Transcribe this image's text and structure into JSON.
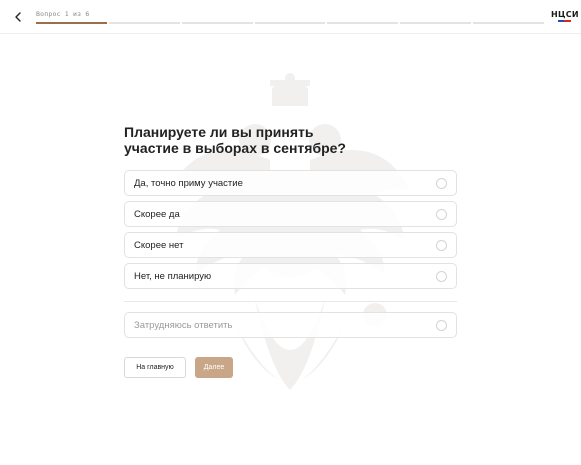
{
  "header": {
    "progress_label": "Вопрос 1 из 6",
    "progress": {
      "current": 1,
      "total": 7
    },
    "logo_text": "НЦСИ",
    "logo_flag_colors": [
      "#ffffff",
      "#1c4fb8",
      "#d52b1e"
    ]
  },
  "colors": {
    "accent": "#9b6e49",
    "button_primary": "#c9a688"
  },
  "question": {
    "line1": "Планируете ли вы принять",
    "line2": "участие в выборах в сентябре?"
  },
  "options": [
    {
      "label": "Да, точно приму участие",
      "selected": false
    },
    {
      "label": "Скорее да",
      "selected": false
    },
    {
      "label": "Скорее нет",
      "selected": false
    },
    {
      "label": "Нет, не планирую",
      "selected": false
    }
  ],
  "other_option": {
    "label": "Затрудняюсь ответить",
    "selected": false
  },
  "buttons": {
    "home_label": "На главную",
    "next_label": "Далее"
  },
  "icons": {
    "back": "chevron-left-icon",
    "watermark": "coat-of-arms-emblem"
  }
}
